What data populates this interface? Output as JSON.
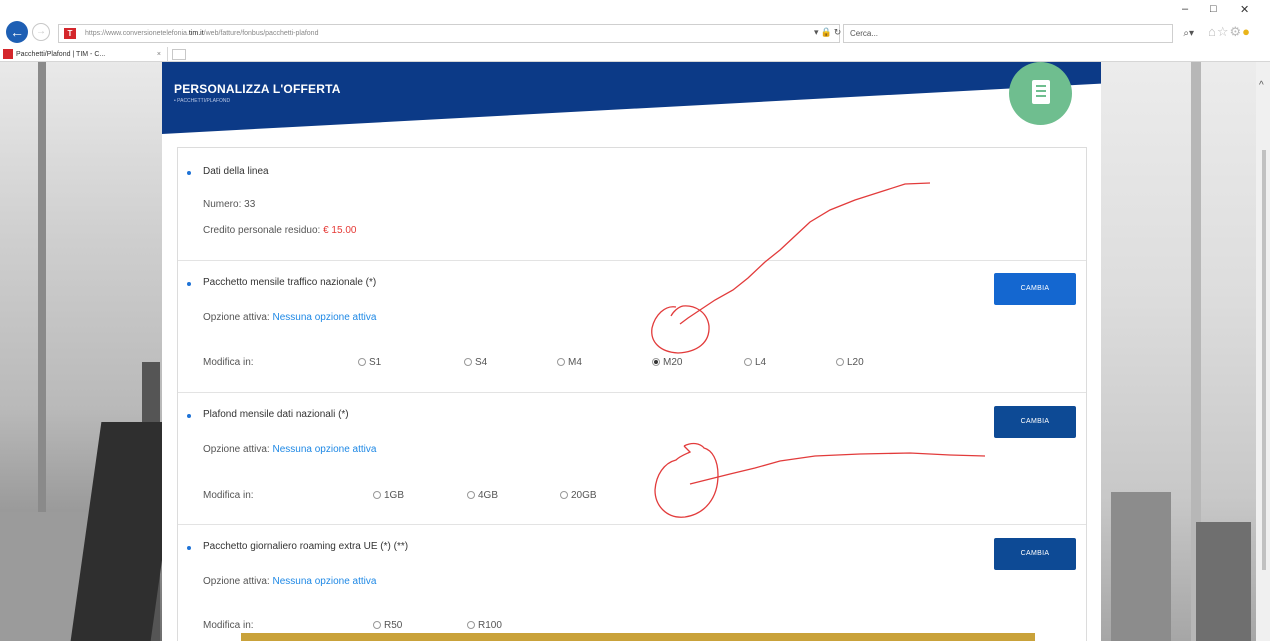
{
  "browser": {
    "url_prefix": "https://www.conversionetelefonia.",
    "url_host": "tim.it",
    "url_path": "/web/fatture/fonbus/pacchetti-plafond",
    "search_placeholder": "Cerca...",
    "tab_title": "Pacchetti/Plafond | TIM - C...",
    "window_controls": [
      "–",
      "□",
      "✕"
    ]
  },
  "header": {
    "title": "PERSONALIZZA L'OFFERTA",
    "subtitle": "• PACCHETTI/PLAFOND"
  },
  "line_data": {
    "title": "Dati della linea",
    "numero_label": "Numero:",
    "numero_value": "33",
    "credito_label": "Credito personale residuo:",
    "credito_value": "€ 15.00"
  },
  "sections": [
    {
      "title": "Pacchetto mensile traffico nazionale (*)",
      "active_label": "Opzione attiva:",
      "active_value": "Nessuna opzione attiva",
      "modify_label": "Modifica in:",
      "button": "CAMBIA",
      "options": [
        "S1",
        "S4",
        "M4",
        "M20",
        "L4",
        "L20"
      ],
      "selected": "M20"
    },
    {
      "title": "Plafond mensile dati nazionali (*)",
      "active_label": "Opzione attiva:",
      "active_value": "Nessuna opzione attiva",
      "modify_label": "Modifica in:",
      "button": "CAMBIA",
      "options": [
        "1GB",
        "4GB",
        "20GB"
      ]
    },
    {
      "title": "Pacchetto giornaliero roaming extra UE (*) (**)",
      "active_label": "Opzione attiva:",
      "active_value": "Nessuna opzione attiva",
      "modify_label": "Modifica in:",
      "button": "CAMBIA",
      "options": [
        "R50",
        "R100"
      ]
    }
  ],
  "colors": {
    "header_blue": "#0c3a87",
    "button_active": "#1467d0",
    "button_dark": "#0d4a95",
    "doc_circle": "#6fbe8f",
    "credit_red": "#e53935",
    "link_blue": "#1e88e5",
    "annotation_red": "#e23b3b"
  }
}
